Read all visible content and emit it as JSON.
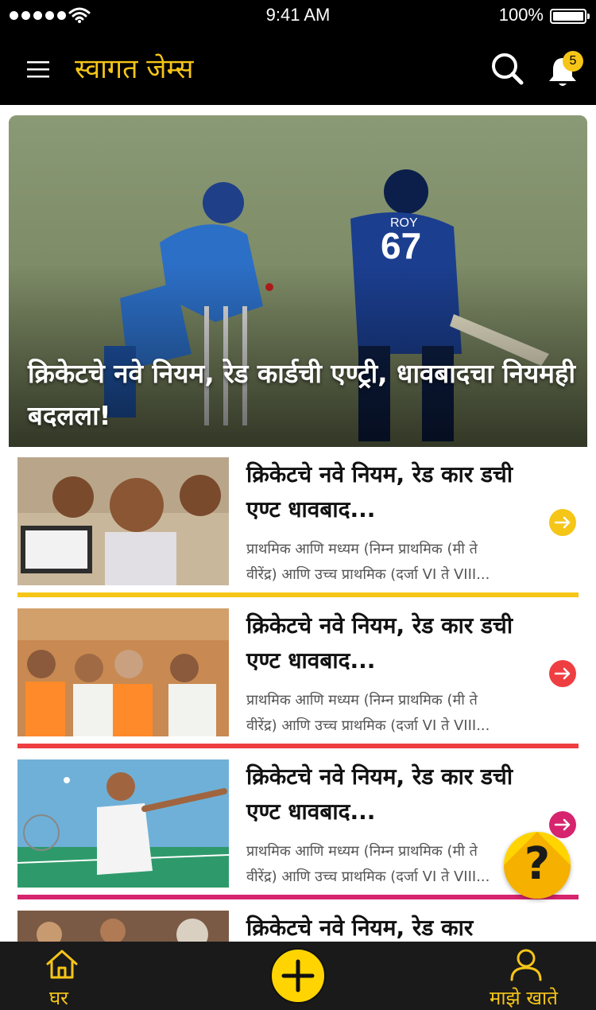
{
  "status_bar": {
    "time": "9:41 AM",
    "battery": "100%"
  },
  "header": {
    "title": "स्वागत जेम्स",
    "notification_count": "5"
  },
  "hero": {
    "title": "क्रिकेटचे नवे नियम, रेड कार्डची एण्ट्री, धावबादचा नियमही बदलला!"
  },
  "news": [
    {
      "headline": "क्रिकेटचे नवे नियम, रेड कार डची एण्ट धावबाद...",
      "summary_line1": "प्राथमिक आणि मध्यम (निम्न प्राथमिक (मी ते",
      "summary_line2": "वीरेंद्र) आणि उच्च प्राथमिक (दर्जा VI ते VIII...",
      "accent": "#f5c518"
    },
    {
      "headline": "क्रिकेटचे नवे नियम, रेड कार डची एण्ट धावबाद...",
      "summary_line1": "प्राथमिक आणि मध्यम (निम्न प्राथमिक (मी ते",
      "summary_line2": "वीरेंद्र) आणि उच्च प्राथमिक (दर्जा VI ते VIII...",
      "accent": "#ef3e42"
    },
    {
      "headline": "क्रिकेटचे नवे नियम, रेड कार डची एण्ट धावबाद...",
      "summary_line1": "प्राथमिक आणि मध्यम (निम्न प्राथमिक (मी ते",
      "summary_line2": "वीरेंद्र) आणि उच्च प्राथमिक (दर्जा VI ते VIII...",
      "accent": "#d6246e"
    },
    {
      "headline": "क्रिकेटचे नवे नियम, रेड कार",
      "summary_line1": "",
      "summary_line2": "",
      "accent": "#f5c518"
    }
  ],
  "help_button": {
    "label": "?"
  },
  "bottom_nav": {
    "home_label": "घर",
    "account_label": "माझे खाते"
  },
  "colors": {
    "brand": "#f5c518",
    "header_bg": "#000000",
    "nav_bg": "#1a1a1a"
  }
}
